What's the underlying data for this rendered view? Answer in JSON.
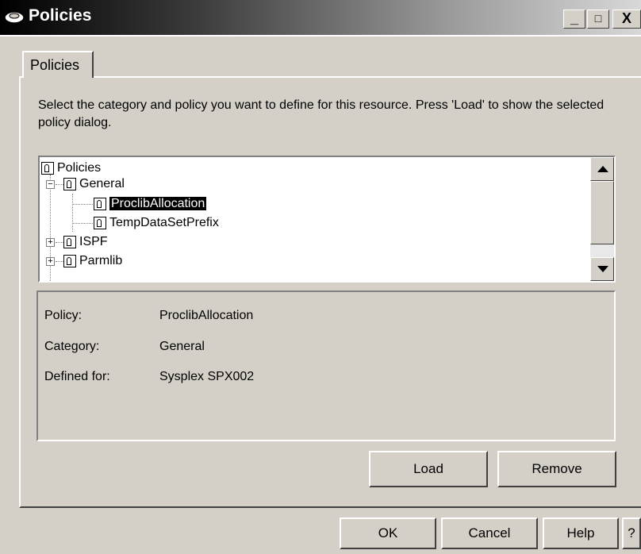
{
  "window": {
    "title": "Policies",
    "minimize_label": "_",
    "maximize_label": "□",
    "close_label": "X"
  },
  "tab": {
    "label": "Policies"
  },
  "description": "Select the category and policy you want to define for this resource. Press 'Load' to show the selected policy dialog.",
  "tree": {
    "root": "Policies",
    "items": [
      {
        "label": "General",
        "level": 1,
        "expander": "−"
      },
      {
        "label": "ProclibAllocation",
        "level": 2,
        "selected": true
      },
      {
        "label": "TempDataSetPrefix",
        "level": 2
      },
      {
        "label": "ISPF",
        "level": 1,
        "expander": "+"
      },
      {
        "label": "Parmlib",
        "level": 1,
        "expander": "+"
      }
    ]
  },
  "details": {
    "policy_label": "Policy:",
    "policy_value": "ProclibAllocation",
    "category_label": "Category:",
    "category_value": "General",
    "defined_label": "Defined for:",
    "defined_value": "Sysplex SPX002"
  },
  "buttons": {
    "load": "Load",
    "remove": "Remove",
    "ok": "OK",
    "cancel": "Cancel",
    "help": "Help",
    "whats_this": "?"
  }
}
